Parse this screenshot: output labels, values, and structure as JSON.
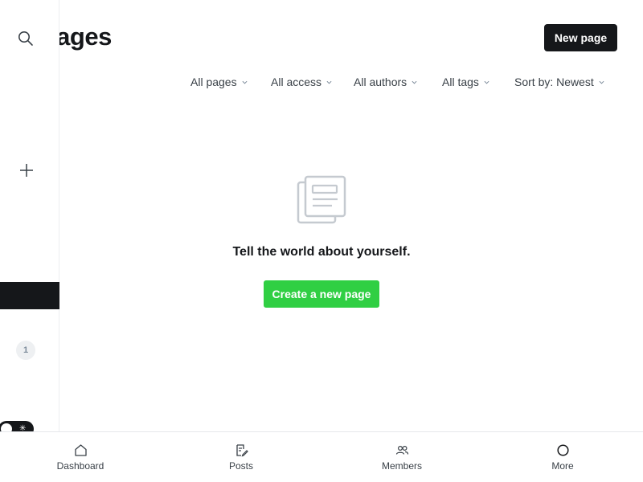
{
  "header": {
    "title": "Pages",
    "new_page_label": "New page"
  },
  "filters": [
    {
      "label": "All pages"
    },
    {
      "label": "All access"
    },
    {
      "label": "All authors"
    },
    {
      "label": "All tags"
    },
    {
      "label": "Sort by: Newest"
    }
  ],
  "empty_state": {
    "icon": "page-icon",
    "message": "Tell the world about yourself.",
    "cta_label": "Create a new page"
  },
  "sidebar": {
    "search_icon": "search-icon",
    "add_icon": "plus-icon",
    "count_badge": "1",
    "theme_toggle_icon": "sun-icon"
  },
  "bottom_nav": [
    {
      "label": "Dashboard",
      "icon": "home-icon"
    },
    {
      "label": "Posts",
      "icon": "posts-icon"
    },
    {
      "label": "Members",
      "icon": "members-icon"
    },
    {
      "label": "More",
      "icon": "circle-icon"
    }
  ],
  "colors": {
    "primary_dark": "#15171a",
    "accent_green": "#30cf43",
    "muted_text": "#394047",
    "icon_grey": "#c5cad0"
  }
}
